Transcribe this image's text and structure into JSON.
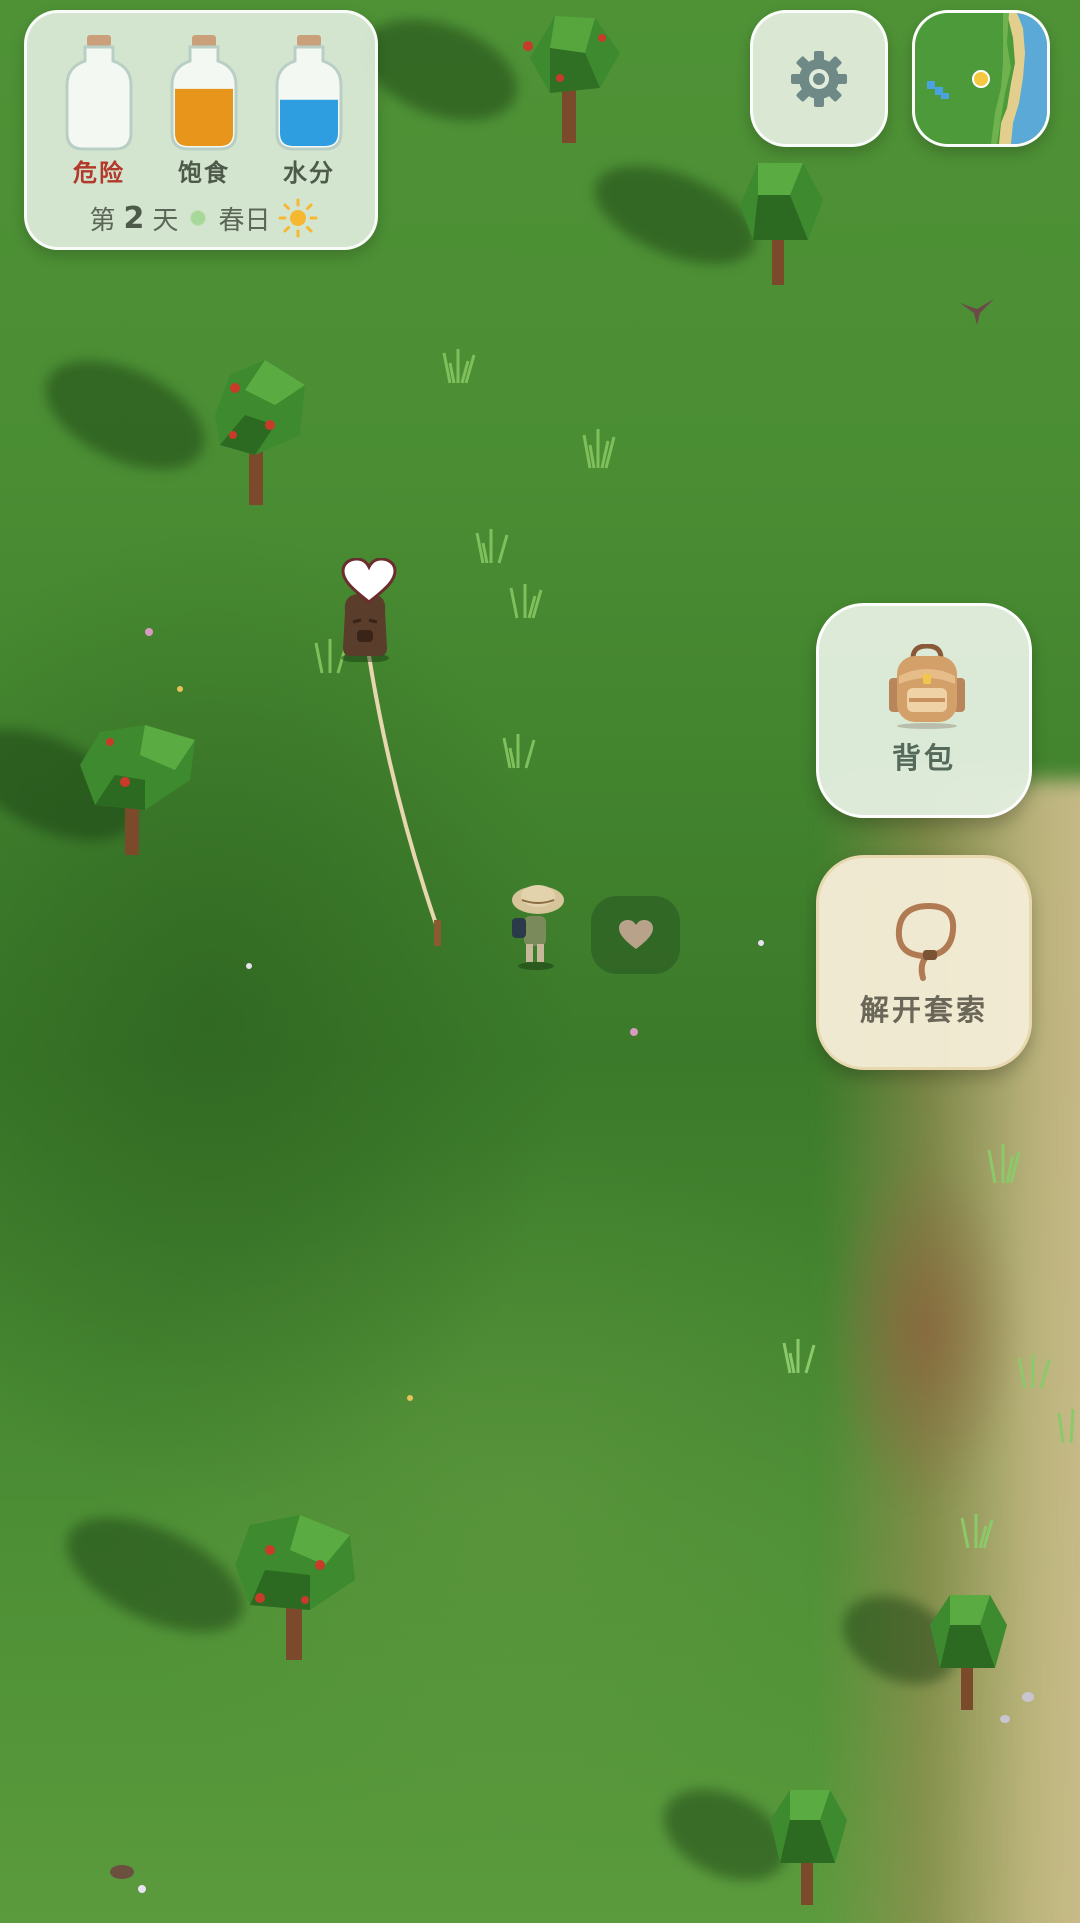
{
  "hud": {
    "gauges": [
      {
        "name": "danger",
        "label": "危险",
        "fill": 0.0,
        "color": "#ffffff",
        "label_color": "#b23a2c"
      },
      {
        "name": "satiety",
        "label": "饱食",
        "fill": 0.72,
        "color": "#e8951c",
        "label_color": "#4d5a4a"
      },
      {
        "name": "water",
        "label": "水分",
        "fill": 0.58,
        "color": "#2f9ee0",
        "label_color": "#4d5a4a"
      }
    ],
    "day": {
      "prefix": "第",
      "number": "2",
      "suffix": "天",
      "season": "春日",
      "weather_icon": "sun-icon"
    }
  },
  "top_buttons": {
    "settings_icon": "gear-icon",
    "minimap_icon": "minimap"
  },
  "actions": {
    "backpack": {
      "label": "背包",
      "icon": "backpack-icon"
    },
    "lasso": {
      "label": "解开套索",
      "icon": "lasso-icon"
    }
  },
  "world": {
    "creature_icon": "heart-icon",
    "interact_icon": "heart-icon"
  },
  "colors": {
    "grass": "#4a8d33",
    "panel": "#deecda",
    "sun": "#f5b830"
  }
}
